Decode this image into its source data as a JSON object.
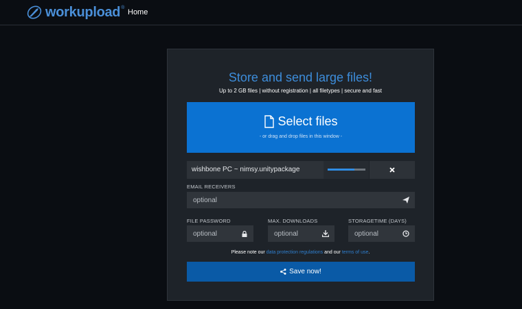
{
  "brand": {
    "name": "workupload",
    "reg": "®"
  },
  "nav": {
    "home_label": "Home"
  },
  "headline": "Store and send large files!",
  "subline": "Up to 2 GB files | without registration | all filetypes | secure and fast",
  "select": {
    "title": "Select files",
    "subtitle": "- or drag and drop files in this window -"
  },
  "file": {
    "name": "wishbone PC ~ nimsy.unitypackage",
    "progress": 0.7
  },
  "email": {
    "label": "EMAIL RECEIVERS",
    "placeholder": "optional"
  },
  "password": {
    "label": "FILE PASSWORD",
    "placeholder": "optional"
  },
  "downloads": {
    "label": "MAX. DOWNLOADS",
    "placeholder": "optional"
  },
  "storage": {
    "label": "STORAGETIME (DAYS)",
    "placeholder": "optional"
  },
  "note": {
    "prefix": "Please note our",
    "link1": "data protection regulations",
    "middle": "and our",
    "link2": "terms of use",
    "suffix": "."
  },
  "save_label": "Save now!",
  "colors": {
    "accent": "#0b72d2",
    "button": "#0a5aa6",
    "link": "#2f7fcf"
  },
  "icons": [
    "rocket-logo-icon",
    "file-icon",
    "close-icon",
    "send-icon",
    "lock-icon",
    "download-icon",
    "clock-icon",
    "share-icon"
  ]
}
